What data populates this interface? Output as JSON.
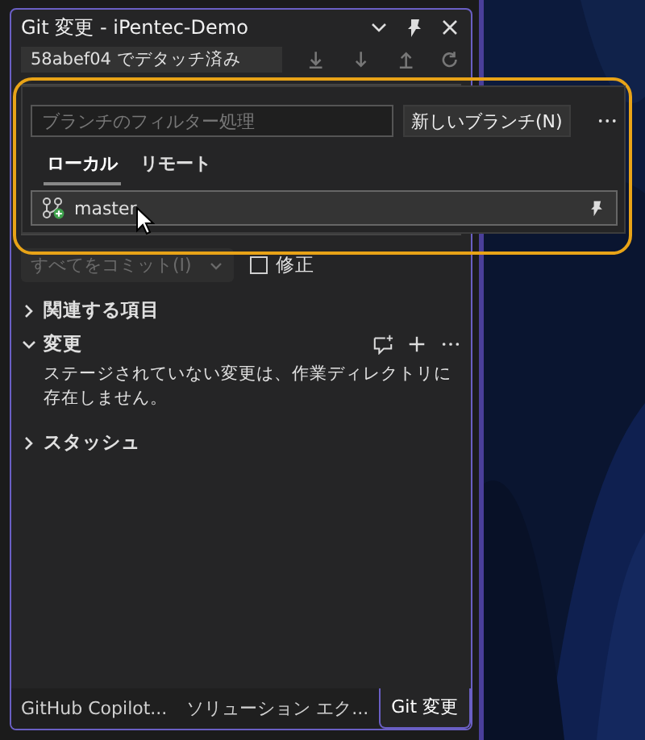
{
  "panel": {
    "title": "Git 変更 - iPentec-Demo",
    "branch": "58abef04 でデタッチ済み",
    "commit_button": {
      "label": "すべてをコミット(I)",
      "disabled": true
    },
    "amend": {
      "label": "修正",
      "checked": false
    },
    "sections": [
      {
        "label": "関連する項目",
        "expanded": false
      },
      {
        "label": "変更",
        "expanded": true,
        "message": "ステージされていない変更は、作業ディレクトリに存在しません。"
      },
      {
        "label": "スタッシュ",
        "expanded": false
      }
    ]
  },
  "branch_popup": {
    "filter_placeholder": "ブランチのフィルター処理",
    "new_branch_button": "新しいブランチ(N)",
    "tabs": [
      {
        "label": "ローカル",
        "selected": true
      },
      {
        "label": "リモート",
        "selected": false
      }
    ],
    "branches": [
      {
        "name": "master",
        "selected": true
      }
    ]
  },
  "bottom_tabs": [
    {
      "label": "GitHub Copilot...",
      "selected": false
    },
    {
      "label": "ソリューション エク...",
      "selected": false
    },
    {
      "label": "Git 変更",
      "selected": true
    }
  ]
}
